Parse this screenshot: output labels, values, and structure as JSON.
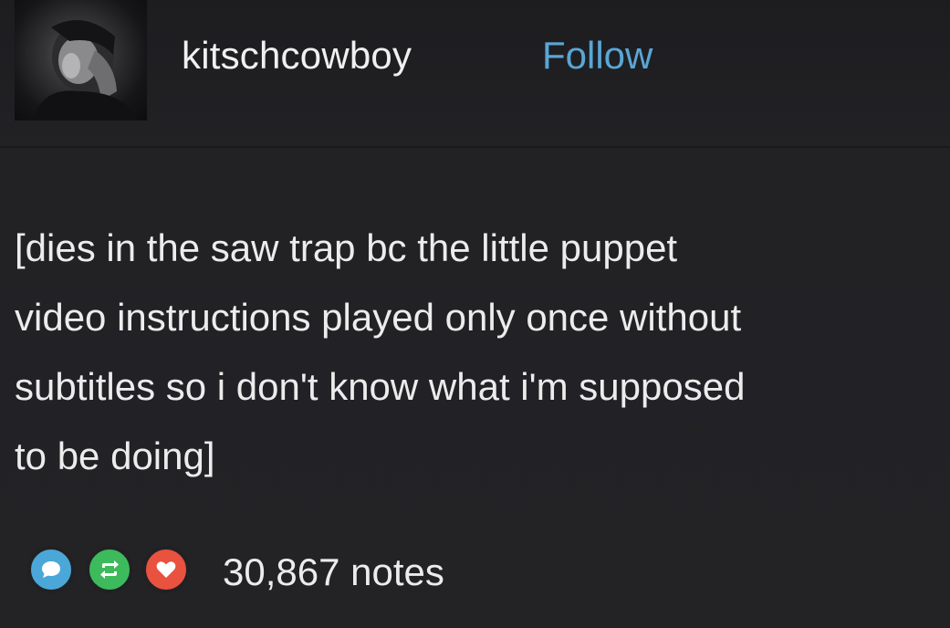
{
  "post": {
    "author": {
      "username": "kitschcowboy",
      "follow_label": "Follow",
      "avatar_icon": "user-avatar-photo"
    },
    "body": {
      "lines": [
        "[dies in the saw trap bc the little puppet",
        "video instructions played only once without",
        "subtitles so i don't know what i'm supposed",
        "to be doing]"
      ]
    },
    "footer": {
      "notes": "30,867 notes",
      "icons": [
        "reply-icon",
        "reblog-icon",
        "like-icon"
      ]
    }
  },
  "colors": {
    "background": "#212124",
    "text": "#ececec",
    "follow": "#5aa6d6",
    "reply": "#4ba7d8",
    "reblog": "#3dbb5c",
    "like": "#e8523f"
  }
}
